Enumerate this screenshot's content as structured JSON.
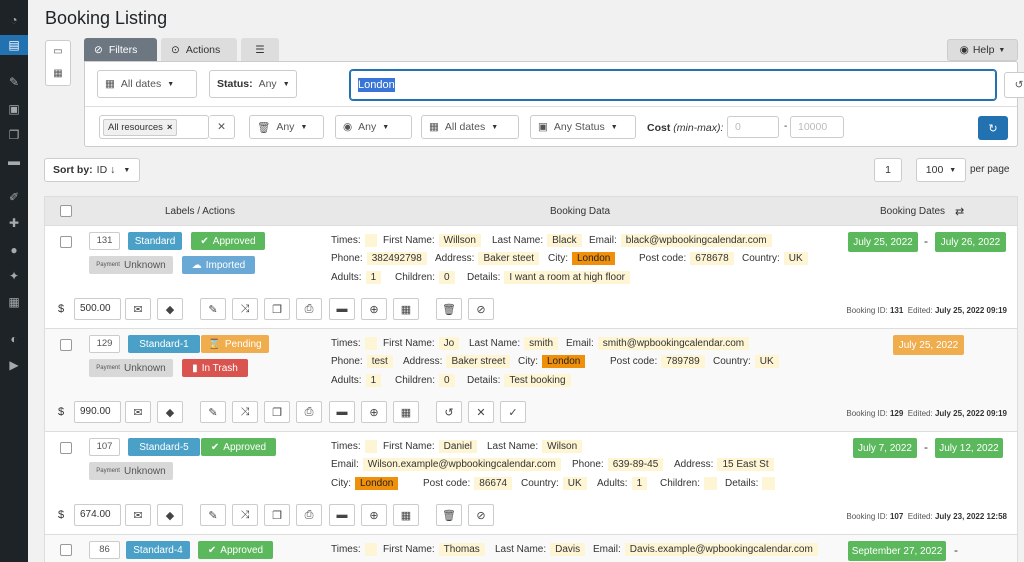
{
  "page": {
    "title": "Booking Listing"
  },
  "tabs": {
    "filters": "Filters",
    "actions": "Actions",
    "help": "Help"
  },
  "filters": {
    "all_dates": "All dates",
    "status_label": "Status:",
    "status_value": "Any",
    "search_value": "London",
    "resources_chip": "All resources",
    "any1": "Any",
    "any2": "Any",
    "all_dates2": "All dates",
    "any_status": "Any Status",
    "cost_label": "Cost",
    "cost_sub": "(min-max):",
    "cost_min_placeholder": "0",
    "cost_max_placeholder": "10000",
    "cost_dash": "-"
  },
  "list": {
    "sort_label": "Sort by:",
    "sort_value": "ID ↓",
    "page": "1",
    "per_page_value": "100",
    "per_page_label": "per page"
  },
  "table": {
    "col_labels": "Labels / Actions",
    "col_data": "Booking Data",
    "col_dates": "Booking Dates"
  },
  "labels": {
    "times": "Times:",
    "first_name": "First Name:",
    "last_name": "Last Name:",
    "email": "Email:",
    "phone": "Phone:",
    "address": "Address:",
    "city": "City:",
    "post_code": "Post code:",
    "country": "Country:",
    "adults": "Adults:",
    "children": "Children:",
    "details": "Details:",
    "payment": "Payment",
    "booking_id": "Booking ID:",
    "edited": "Edited:",
    "dollar": "$"
  },
  "bookings": [
    {
      "id": "131",
      "resource": "Standard",
      "status": "Approved",
      "payment_status": "Unknown",
      "extra": "Imported",
      "first_name": "Willson",
      "last_name": "Black",
      "email": "black@wpbookingcalendar.com",
      "phone": "382492798",
      "address": "Baker steet",
      "city": "London",
      "post_code": "678678",
      "country": "UK",
      "adults": "1",
      "children": "0",
      "details": "I want a room at high floor",
      "date_start": "July 25, 2022",
      "date_end": "July 26, 2022",
      "cost": "500.00",
      "booking_id": "131",
      "edited": "July 25, 2022 09:19"
    },
    {
      "id": "129",
      "resource": "Standard-1",
      "status": "Pending",
      "payment_status": "Unknown",
      "extra": "In Trash",
      "first_name": "Jo",
      "last_name": "smith",
      "email": "smith@wpbookingcalendar.com",
      "phone": "test",
      "address": "Baker street",
      "city": "London",
      "post_code": "789789",
      "country": "UK",
      "adults": "1",
      "children": "0",
      "details": "Test booking",
      "date_start": "July 25, 2022",
      "cost": "990.00",
      "booking_id": "129",
      "edited": "July 25, 2022 09:19"
    },
    {
      "id": "107",
      "resource": "Standard-5",
      "status": "Approved",
      "payment_status": "Unknown",
      "first_name": "Daniel",
      "last_name": "Wilson",
      "email": "Wilson.example@wpbookingcalendar.com",
      "phone": "639-89-45",
      "address": "15 East St",
      "city": "London",
      "post_code": "86674",
      "country": "UK",
      "adults": "1",
      "children": "",
      "details": "",
      "date_start": "July 7, 2022",
      "date_end": "July 12, 2022",
      "cost": "674.00",
      "booking_id": "107",
      "edited": "July 23, 2022 12:58"
    },
    {
      "id": "86",
      "resource": "Standard-4",
      "status": "Approved",
      "first_name": "Thomas",
      "last_name": "Davis",
      "email": "Davis.example@wpbookingcalendar.com",
      "date_start": "September 27, 2022",
      "date_dash": "-"
    }
  ],
  "colors": {
    "accent": "#2271b1",
    "approved": "#5cb85c",
    "pending": "#f0ad4e",
    "trash": "#d9534f",
    "resource": "#4aa0c6",
    "highlight": "#f0900a"
  }
}
